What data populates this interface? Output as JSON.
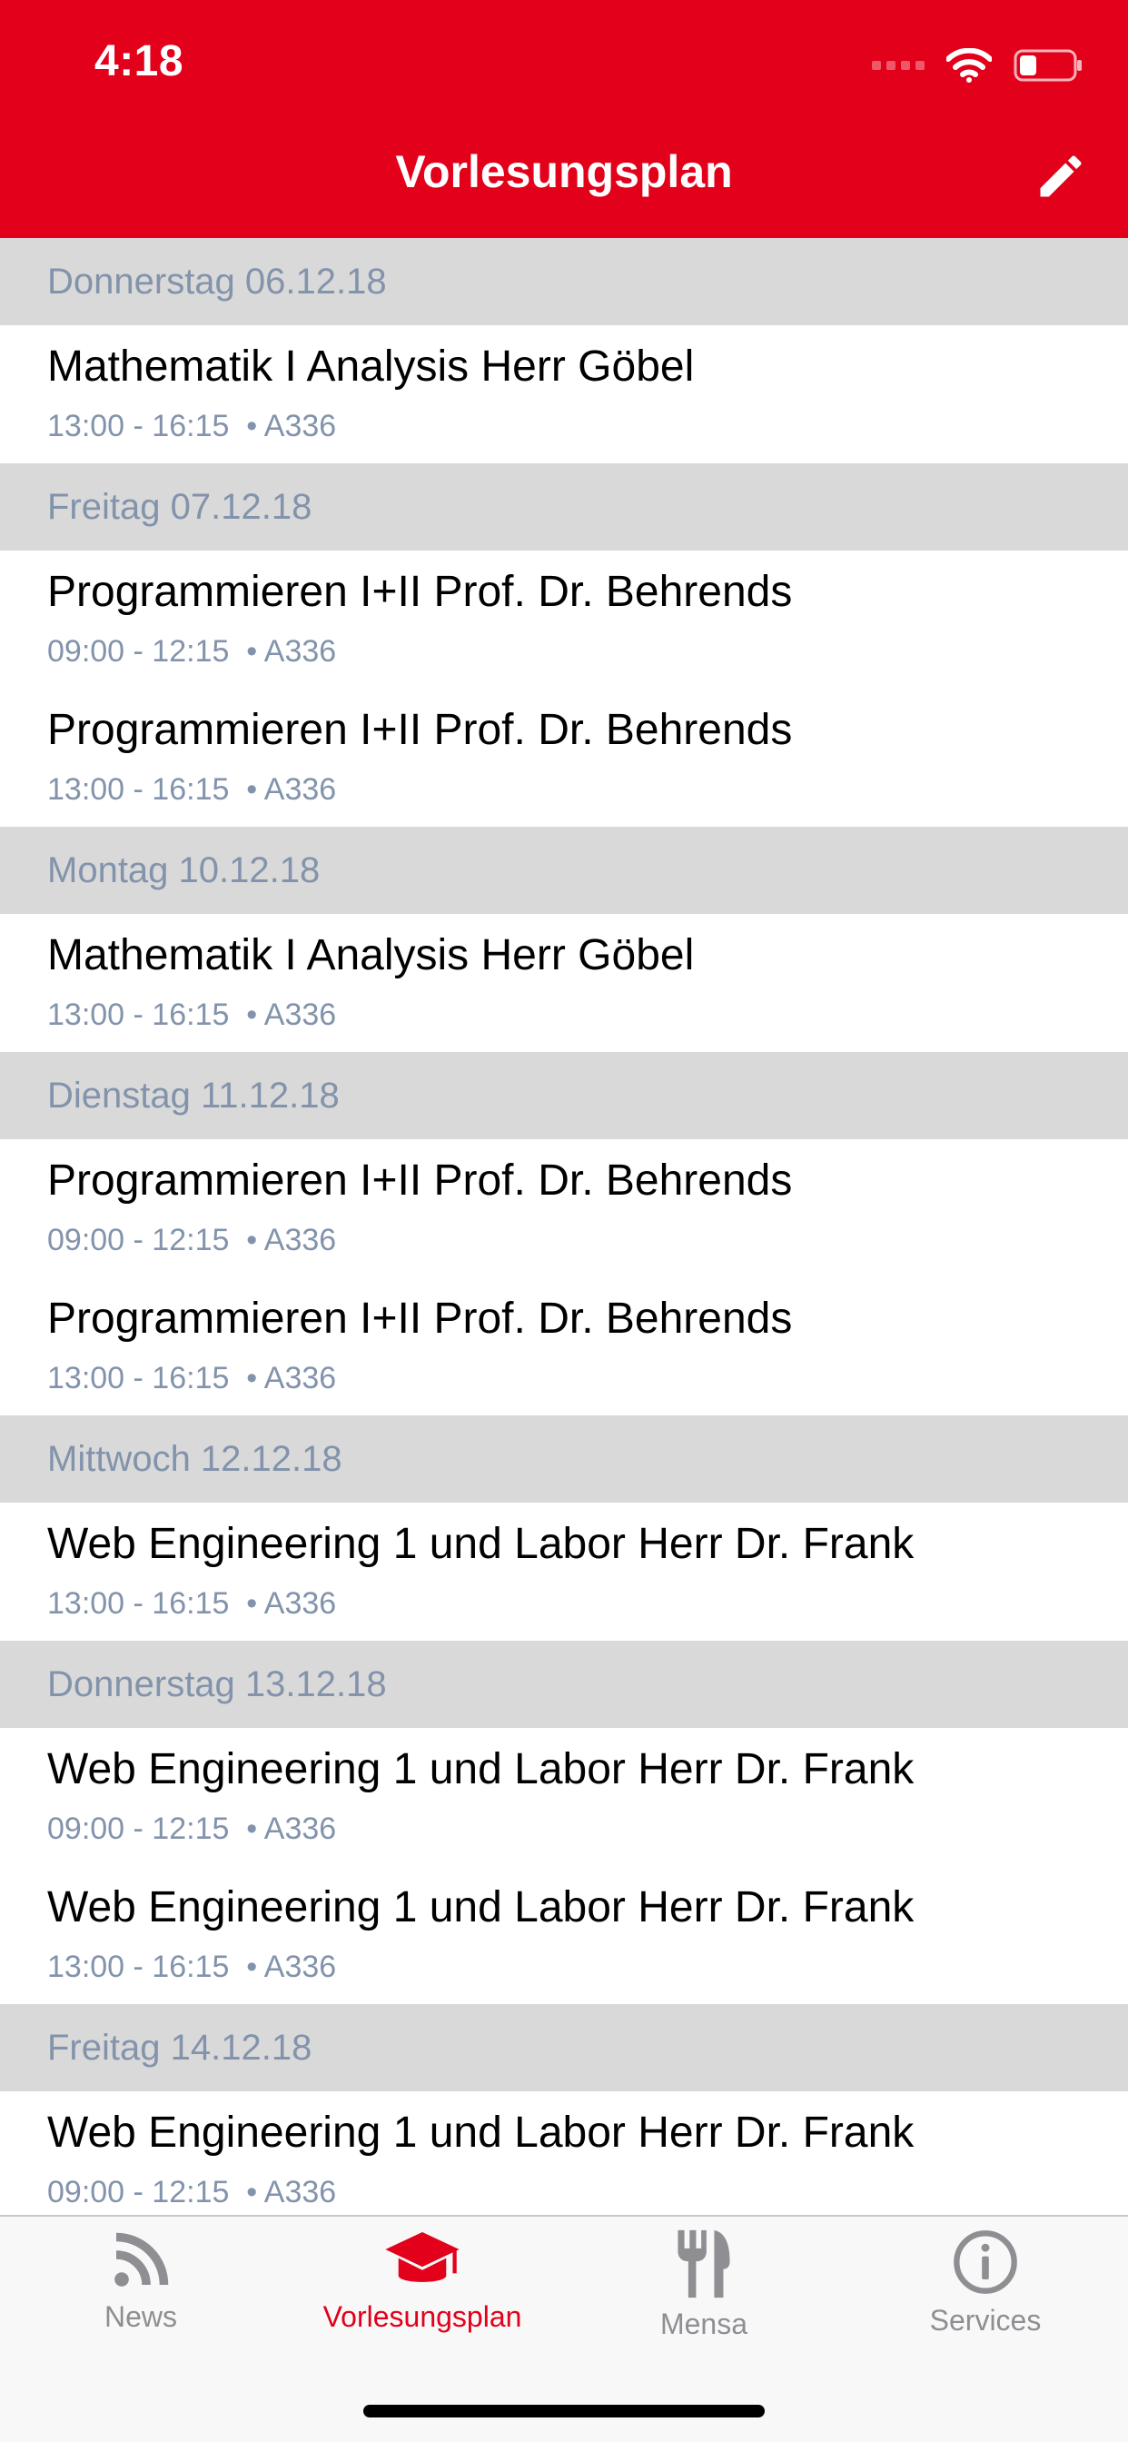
{
  "status": {
    "time": "4:18"
  },
  "header": {
    "title": "Vorlesungsplan",
    "edit_icon": "pencil-icon",
    "color": "#e2001a"
  },
  "days": [
    {
      "label": "Donnerstag 06.12.18",
      "events": [
        {
          "title": "Mathematik I Analysis Herr Göbel",
          "time": "13:00 - 16:15",
          "room": "• A336"
        }
      ]
    },
    {
      "label": "Freitag 07.12.18",
      "events": [
        {
          "title": "Programmieren I+II Prof. Dr. Behrends",
          "time": "09:00 - 12:15",
          "room": "• A336"
        },
        {
          "title": "Programmieren I+II Prof. Dr. Behrends",
          "time": "13:00 - 16:15",
          "room": "• A336"
        }
      ]
    },
    {
      "label": "Montag 10.12.18",
      "events": [
        {
          "title": "Mathematik I Analysis Herr Göbel",
          "time": "13:00 - 16:15",
          "room": "• A336"
        }
      ]
    },
    {
      "label": "Dienstag 11.12.18",
      "events": [
        {
          "title": "Programmieren I+II Prof. Dr. Behrends",
          "time": "09:00 - 12:15",
          "room": "• A336"
        },
        {
          "title": "Programmieren I+II Prof. Dr. Behrends",
          "time": "13:00 - 16:15",
          "room": "• A336"
        }
      ]
    },
    {
      "label": "Mittwoch 12.12.18",
      "events": [
        {
          "title": "Web Engineering 1 und Labor Herr Dr. Frank",
          "time": "13:00 - 16:15",
          "room": "• A336"
        }
      ]
    },
    {
      "label": "Donnerstag 13.12.18",
      "events": [
        {
          "title": "Web Engineering 1 und Labor Herr Dr. Frank",
          "time": "09:00 - 12:15",
          "room": "• A336"
        },
        {
          "title": "Web Engineering 1 und Labor Herr Dr. Frank",
          "time": "13:00 - 16:15",
          "room": "• A336"
        }
      ]
    },
    {
      "label": "Freitag 14.12.18",
      "events": [
        {
          "title": "Web Engineering 1 und Labor Herr Dr. Frank",
          "time": "09:00 - 12:15",
          "room": "• A336"
        }
      ]
    }
  ],
  "tabs": [
    {
      "label": "News",
      "icon": "rss-icon",
      "active": false
    },
    {
      "label": "Vorlesungsplan",
      "icon": "graduation-cap-icon",
      "active": true
    },
    {
      "label": "Mensa",
      "icon": "fork-knife-icon",
      "active": false
    },
    {
      "label": "Services",
      "icon": "info-icon",
      "active": false
    }
  ]
}
